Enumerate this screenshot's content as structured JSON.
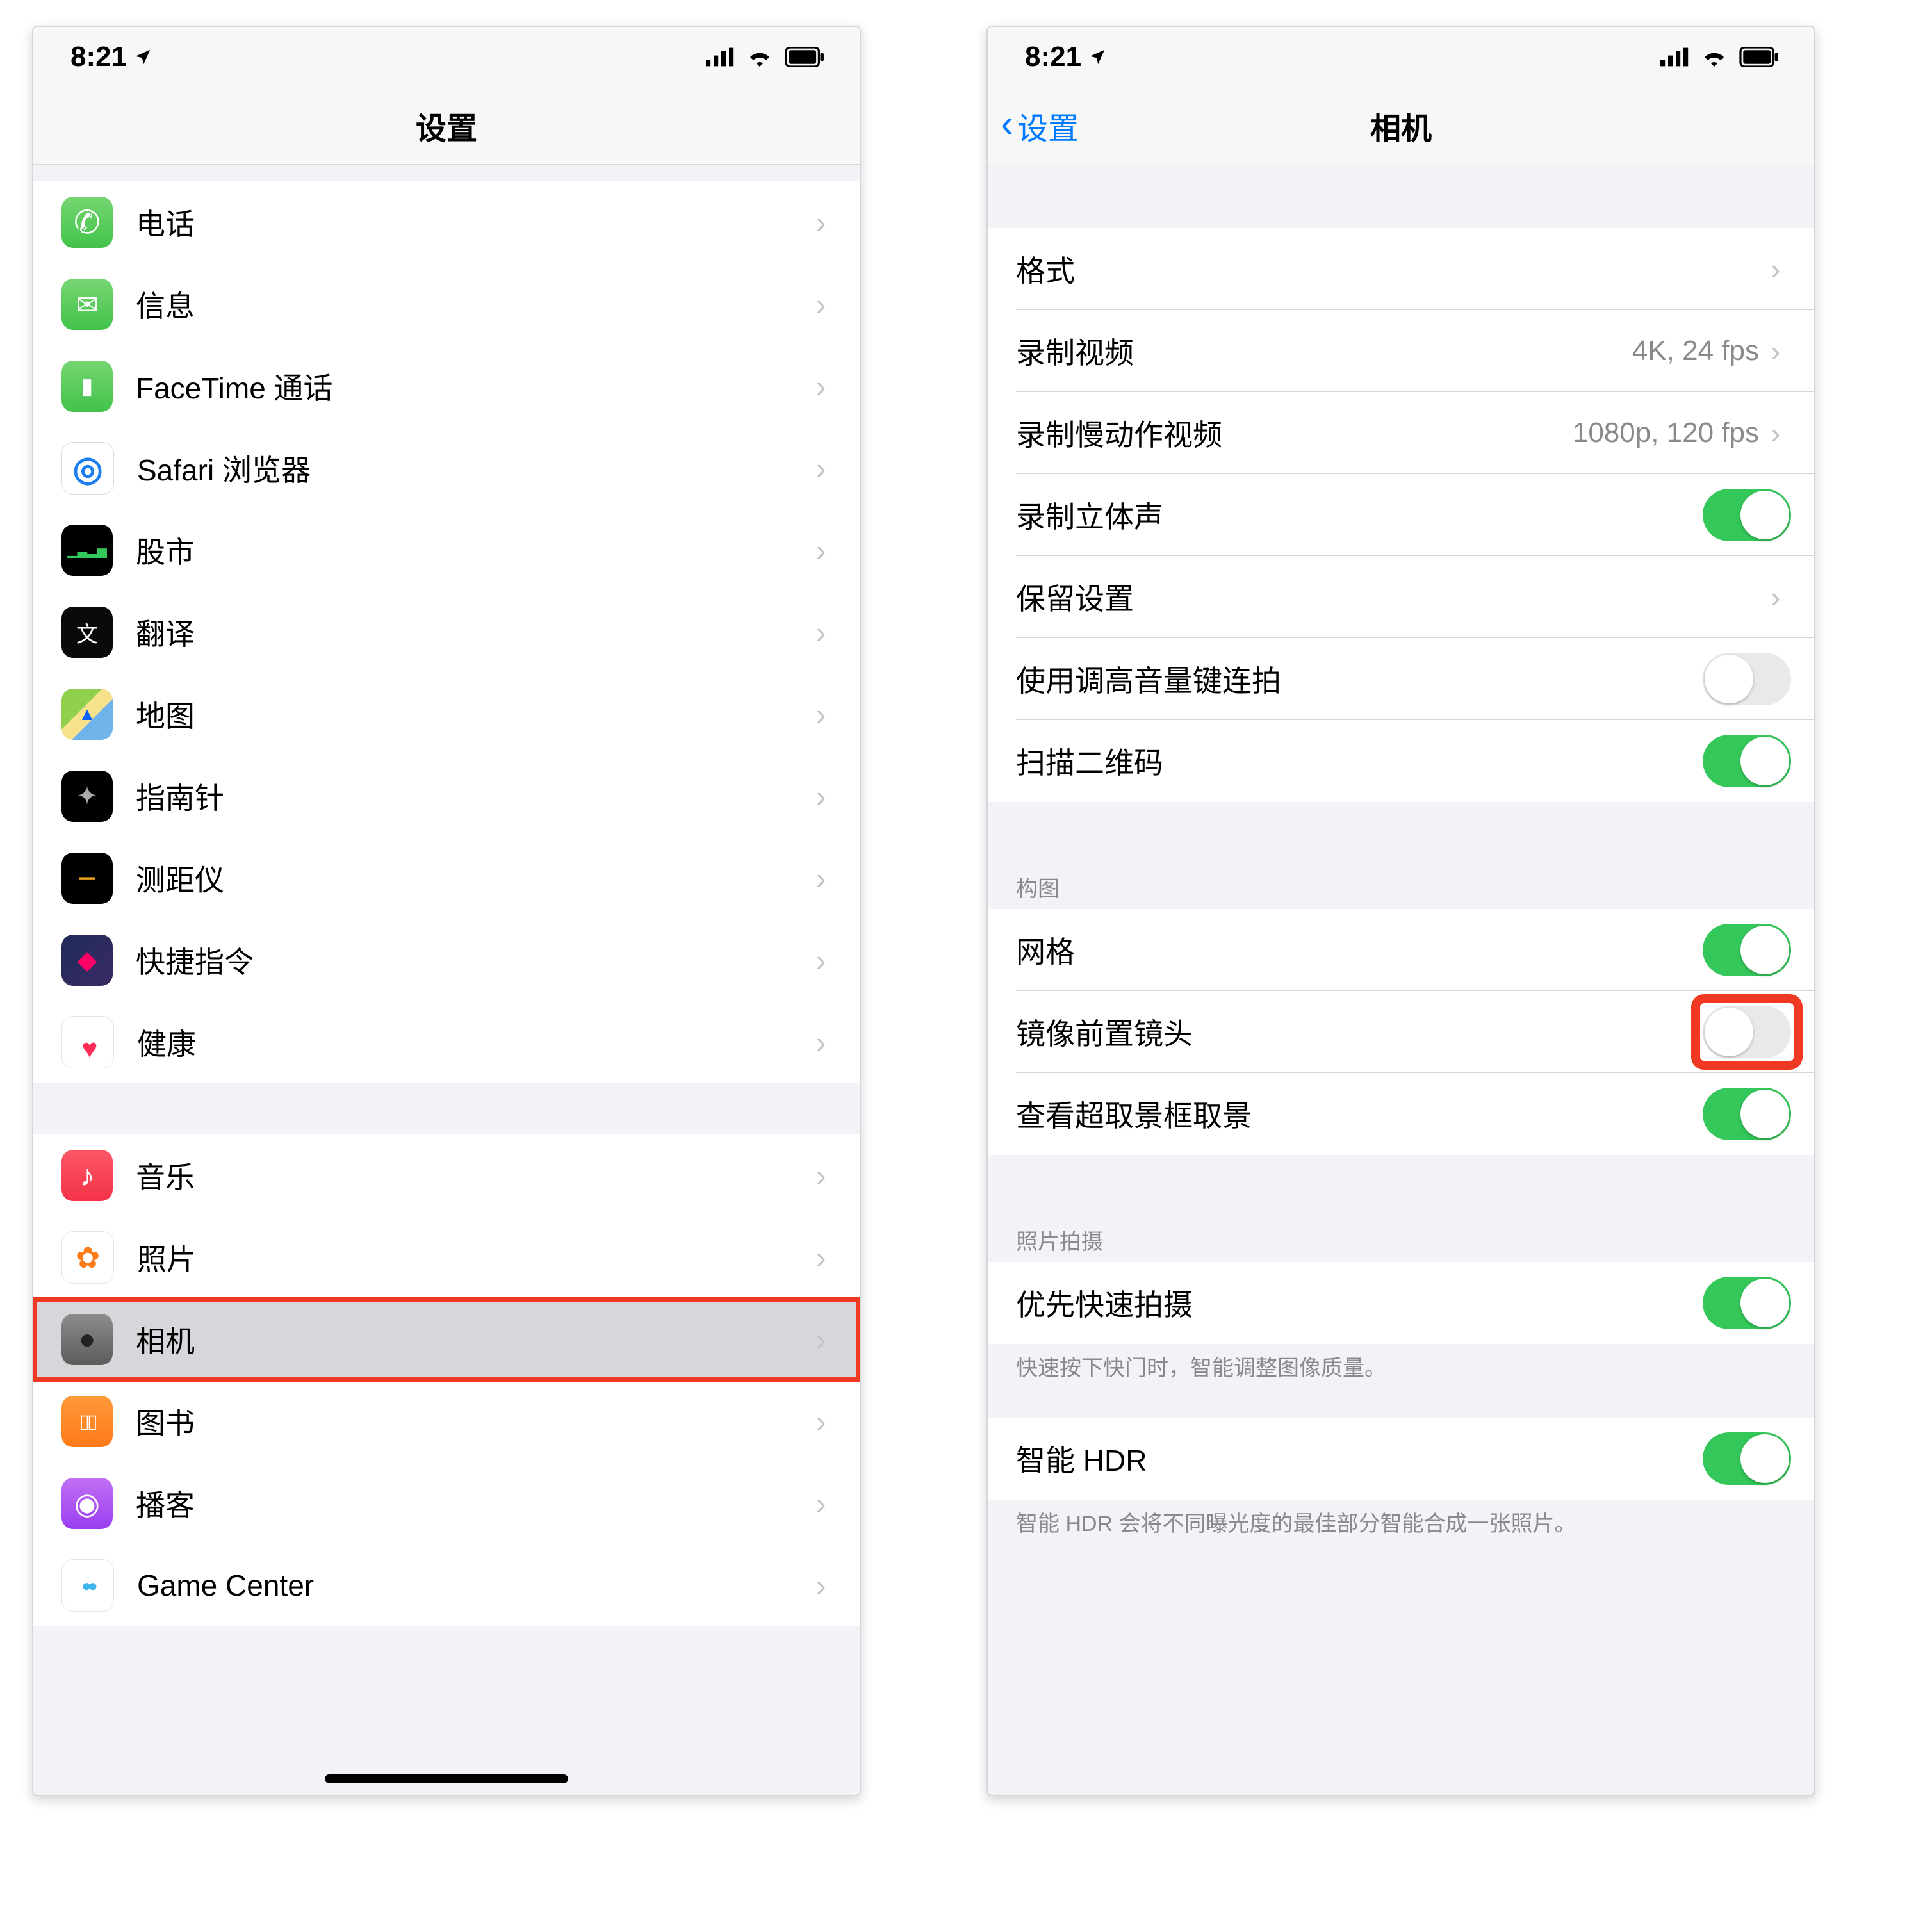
{
  "statusbar": {
    "time": "8:21"
  },
  "left": {
    "nav_title": "设置",
    "groups": [
      {
        "items": [
          {
            "key": "phone",
            "label": "电话",
            "icon": "ic-phone"
          },
          {
            "key": "messages",
            "label": "信息",
            "icon": "ic-messages"
          },
          {
            "key": "facetime",
            "label": "FaceTime 通话",
            "icon": "ic-facetime"
          },
          {
            "key": "safari",
            "label": "Safari 浏览器",
            "icon": "ic-safari"
          },
          {
            "key": "stocks",
            "label": "股市",
            "icon": "ic-stocks"
          },
          {
            "key": "translate",
            "label": "翻译",
            "icon": "ic-translate"
          },
          {
            "key": "maps",
            "label": "地图",
            "icon": "ic-maps"
          },
          {
            "key": "compass",
            "label": "指南针",
            "icon": "ic-compass"
          },
          {
            "key": "measure",
            "label": "测距仪",
            "icon": "ic-measure"
          },
          {
            "key": "shortcuts",
            "label": "快捷指令",
            "icon": "ic-shortcuts"
          },
          {
            "key": "health",
            "label": "健康",
            "icon": "ic-health"
          }
        ]
      },
      {
        "items": [
          {
            "key": "music",
            "label": "音乐",
            "icon": "ic-music"
          },
          {
            "key": "photos",
            "label": "照片",
            "icon": "ic-photos"
          },
          {
            "key": "camera",
            "label": "相机",
            "icon": "ic-camera",
            "highlight": true,
            "redbox": true
          },
          {
            "key": "books",
            "label": "图书",
            "icon": "ic-books"
          },
          {
            "key": "podcasts",
            "label": "播客",
            "icon": "ic-podcasts"
          },
          {
            "key": "gamecenter",
            "label": "Game Center",
            "icon": "ic-gamecenter"
          }
        ]
      }
    ]
  },
  "right": {
    "back_label": "设置",
    "nav_title": "相机",
    "sections": [
      {
        "header": "",
        "cells": [
          {
            "key": "formats",
            "label": "格式",
            "type": "nav",
            "detail": ""
          },
          {
            "key": "record-video",
            "label": "录制视频",
            "type": "nav",
            "detail": "4K, 24 fps"
          },
          {
            "key": "record-slomo",
            "label": "录制慢动作视频",
            "type": "nav",
            "detail": "1080p, 120 fps"
          },
          {
            "key": "stereo",
            "label": "录制立体声",
            "type": "toggle",
            "on": true
          },
          {
            "key": "preserve",
            "label": "保留设置",
            "type": "nav",
            "detail": ""
          },
          {
            "key": "volume-burst",
            "label": "使用调高音量键连拍",
            "type": "toggle",
            "on": false
          },
          {
            "key": "scan-qr",
            "label": "扫描二维码",
            "type": "toggle",
            "on": true
          }
        ]
      },
      {
        "header": "构图",
        "cells": [
          {
            "key": "grid",
            "label": "网格",
            "type": "toggle",
            "on": true
          },
          {
            "key": "mirror-front",
            "label": "镜像前置镜头",
            "type": "toggle",
            "on": false,
            "red_frame_toggle": true
          },
          {
            "key": "view-outside",
            "label": "查看超取景框取景",
            "type": "toggle",
            "on": true
          }
        ]
      },
      {
        "header": "照片拍摄",
        "cells": [
          {
            "key": "prioritize-fast",
            "label": "优先快速拍摄",
            "type": "toggle",
            "on": true
          }
        ],
        "footer": "快速按下快门时，智能调整图像质量。"
      },
      {
        "header": "",
        "cells": [
          {
            "key": "smart-hdr",
            "label": "智能 HDR",
            "type": "toggle",
            "on": true
          }
        ],
        "footer": "智能 HDR 会将不同曝光度的最佳部分智能合成一张照片。"
      }
    ]
  }
}
